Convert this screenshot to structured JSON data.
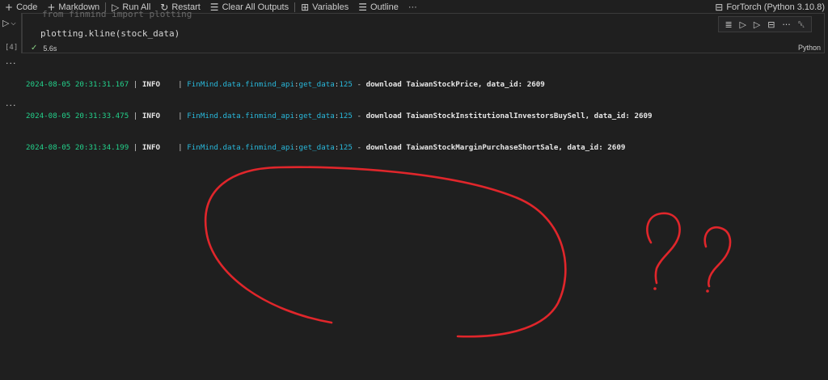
{
  "toolbar": {
    "code_label": "Code",
    "markdown_label": "Markdown",
    "run_all_label": "Run All",
    "restart_label": "Restart",
    "clear_outputs_label": "Clear All Outputs",
    "variables_label": "Variables",
    "outline_label": "Outline",
    "more_label": "···",
    "kernel_label": "ForTorch (Python 3.10.8)"
  },
  "cell": {
    "execution_count": "[4]",
    "partial_code": "from finmind import plotting",
    "code_line": "plotting.kline(stock_data)",
    "exec_time": "5.6s",
    "language": "Python"
  },
  "output": {
    "ellipsis": "···",
    "logs": [
      {
        "timestamp": "2024-08-05 20:31:31.167",
        "level": "INFO    ",
        "module": "FinMind.data.finmind_api",
        "func": "get_data",
        "lineno": "125",
        "message": "download TaiwanStockPrice, data_id: 2609"
      },
      {
        "timestamp": "2024-08-05 20:31:33.475",
        "level": "INFO    ",
        "module": "FinMind.data.finmind_api",
        "func": "get_data",
        "lineno": "125",
        "message": "download TaiwanStockInstitutionalInvestorsBuySell, data_id: 2609"
      },
      {
        "timestamp": "2024-08-05 20:31:34.199",
        "level": "INFO    ",
        "module": "FinMind.data.finmind_api",
        "func": "get_data",
        "lineno": "125",
        "message": "download TaiwanStockMarginPurchaseShortSale, data_id: 2609"
      }
    ]
  },
  "colors": {
    "background": "#1f1f1f",
    "timestamp": "#23d18b",
    "module": "#29b8db",
    "annotation": "#e0262b"
  }
}
